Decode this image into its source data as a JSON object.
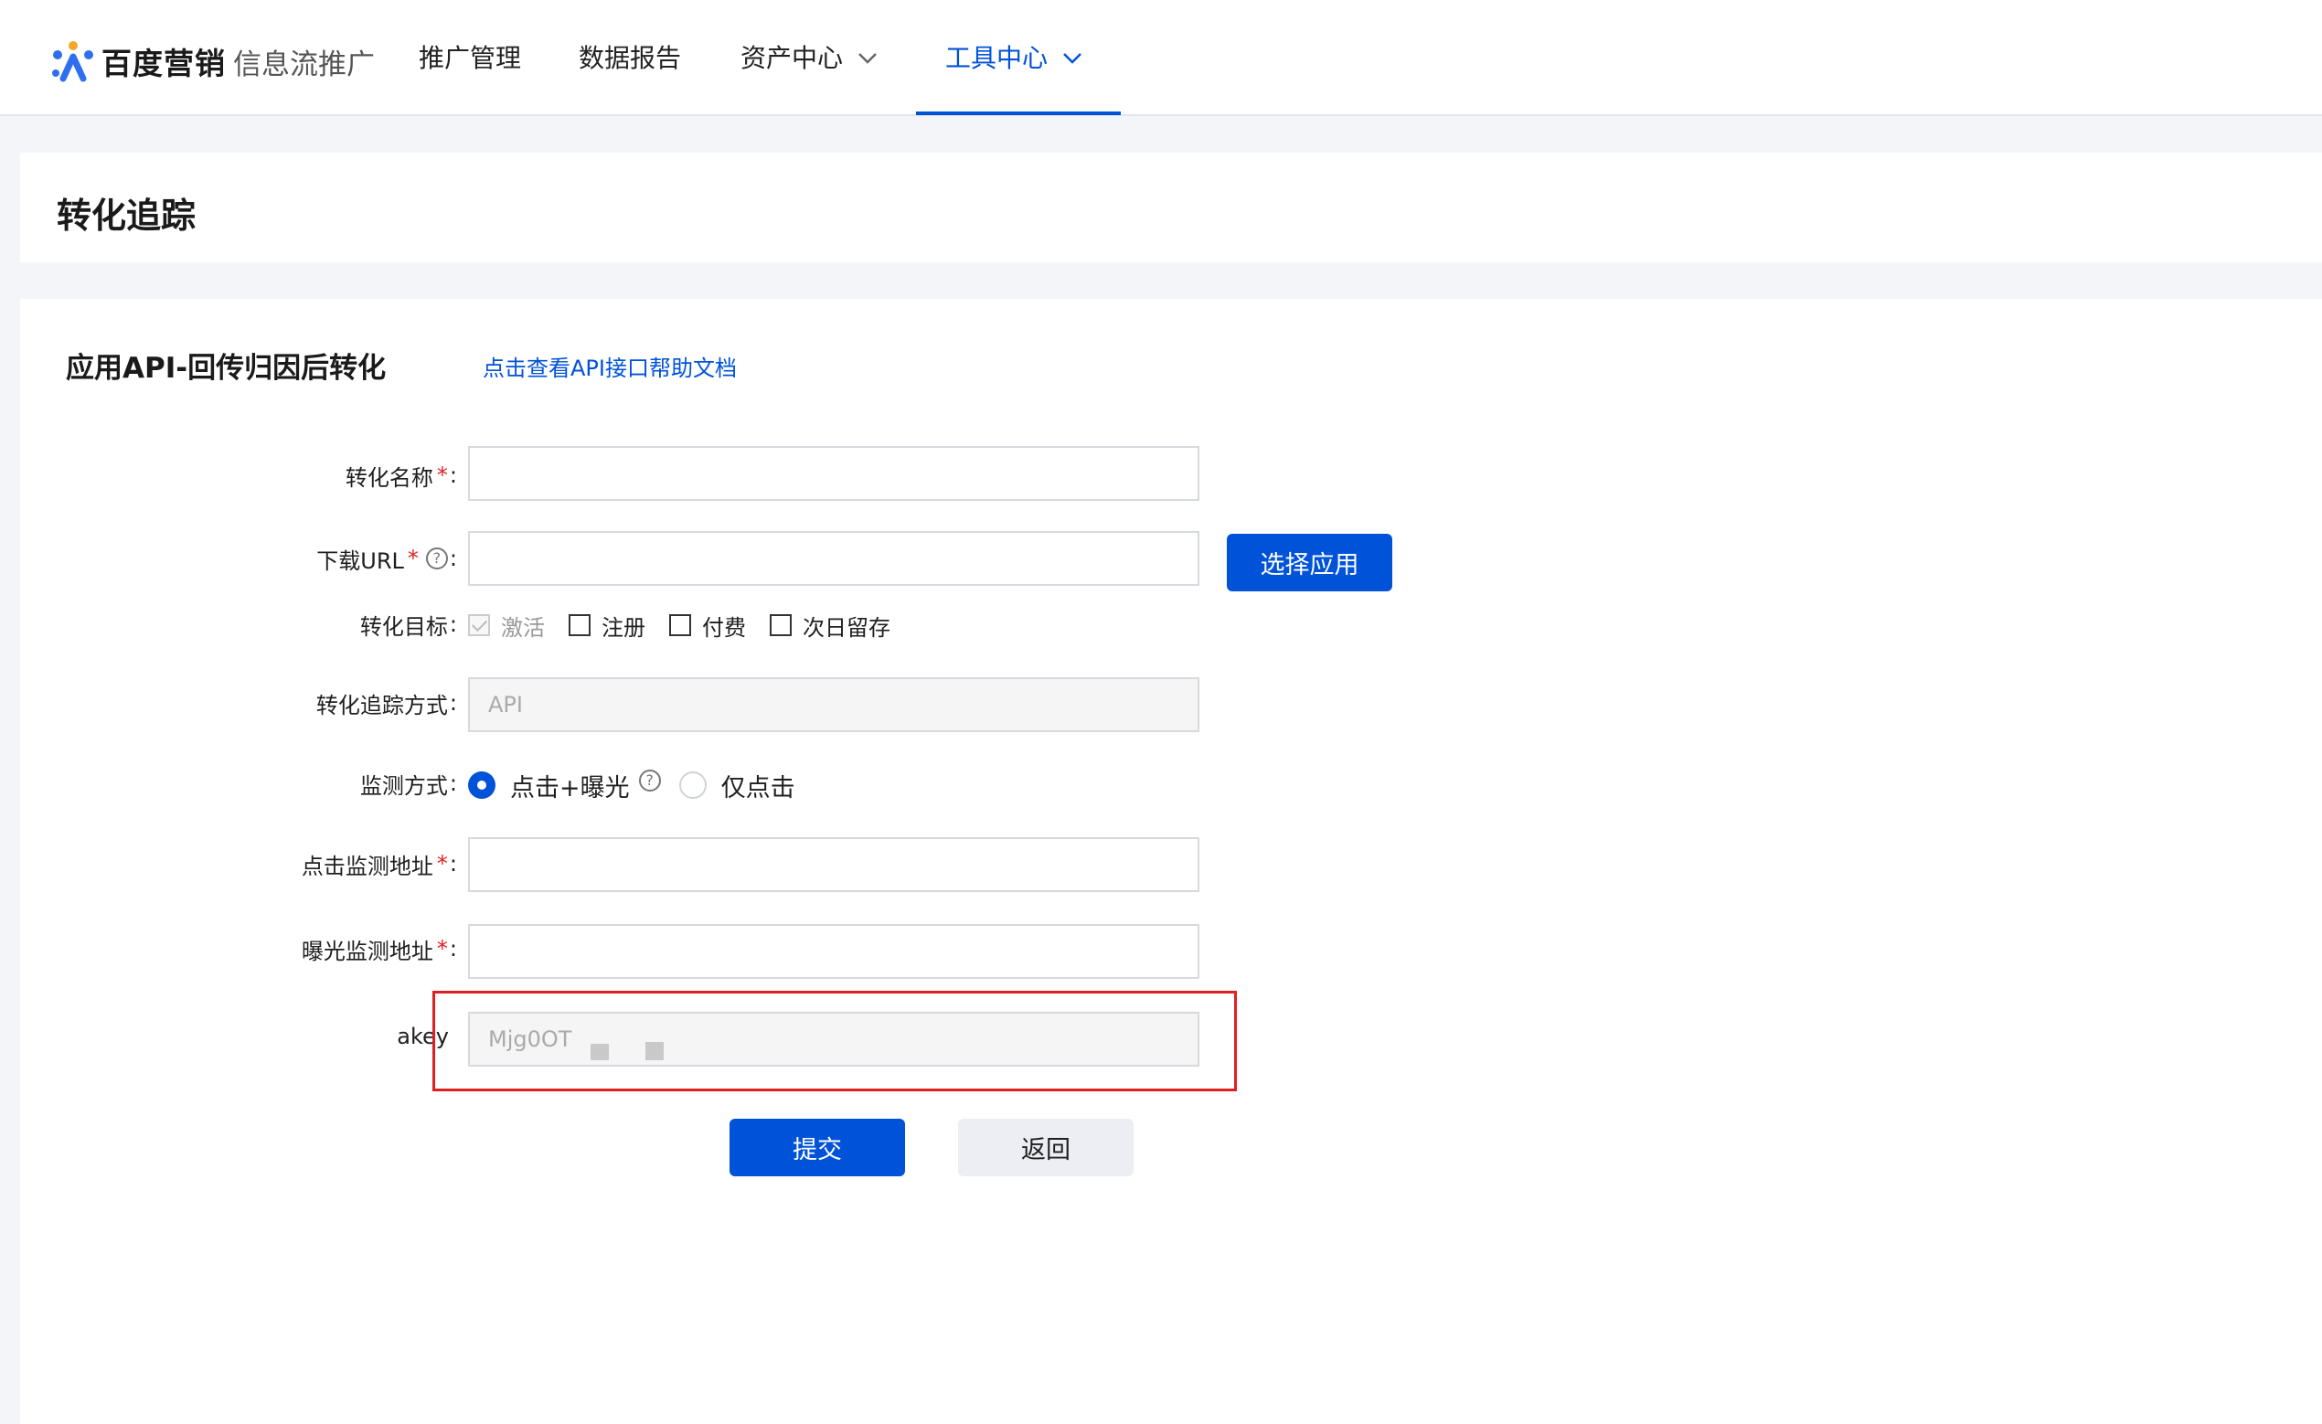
{
  "header": {
    "brand": "百度营销",
    "product": "信息流推广",
    "nav": [
      {
        "label": "推广管理"
      },
      {
        "label": "数据报告"
      },
      {
        "label": "资产中心"
      },
      {
        "label": "工具中心"
      }
    ]
  },
  "page": {
    "title": "转化追踪"
  },
  "form": {
    "section_title": "应用API-回传归因后转化",
    "help_link": "点击查看API接口帮助文档",
    "fields": {
      "name_label": "转化名称",
      "download_url_label": "下载URL",
      "goal_label": "转化目标",
      "goal_options": [
        "激活",
        "注册",
        "付费",
        "次日留存"
      ],
      "tracking_method_label": "转化追踪方式",
      "tracking_method_value": "API",
      "monitor_label": "监测方式",
      "monitor_options": [
        "点击+曝光",
        "仅点击"
      ],
      "click_url_label": "点击监测地址",
      "impression_url_label": "曝光监测地址",
      "akey_label": "akey",
      "akey_value": "Mjg0OT"
    },
    "required_mark": "*",
    "colon": ":",
    "help_mark": "?",
    "select_app_button": "选择应用",
    "submit_button": "提交",
    "back_button": "返回"
  },
  "colors": {
    "accent": "#0052d9",
    "required": "#e02020",
    "highlight": "#e02020"
  }
}
